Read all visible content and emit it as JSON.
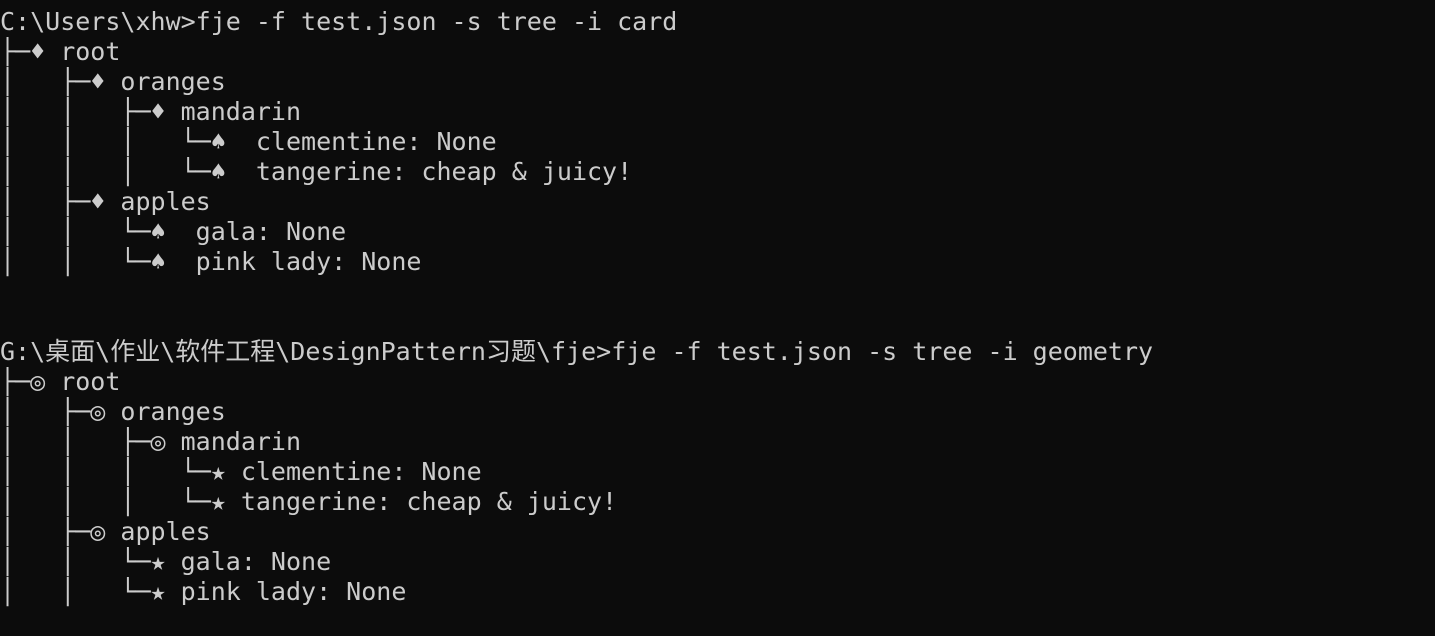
{
  "terminal": {
    "background": "#0c0c0c",
    "foreground": "#cccccc",
    "blocks": [
      {
        "prompt": "C:\\Users\\xhw>",
        "command": "fje -f test.json -s tree -i card",
        "lines": [
          "├─♦ root",
          "│   ├─♦ oranges",
          "│   │   ├─♦ mandarin",
          "│   │   │   └─♠  clementine: None",
          "│   │   │   └─♠  tangerine: cheap & juicy!",
          "│   ├─♦ apples",
          "│   │   └─♠  gala: None",
          "│   │   └─♠  pink lady: None"
        ]
      },
      {
        "prompt": "G:\\桌面\\作业\\软件工程\\DesignPattern习题\\fje>",
        "command": "fje -f test.json -s tree -i geometry",
        "lines": [
          "├─◎ root",
          "│   ├─◎ oranges",
          "│   │   ├─◎ mandarin",
          "│   │   │   └─★ clementine: None",
          "│   │   │   └─★ tangerine: cheap & juicy!",
          "│   ├─◎ apples",
          "│   │   └─★ gala: None",
          "│   │   └─★ pink lady: None"
        ]
      }
    ]
  }
}
